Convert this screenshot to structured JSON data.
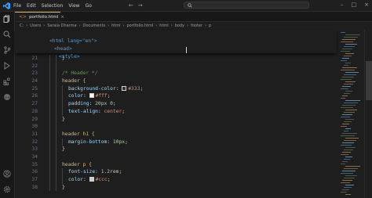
{
  "titlebar": {
    "menu": [
      "File",
      "Edit",
      "Selection",
      "View",
      "Go"
    ],
    "nav_back": "←",
    "nav_forward": "→"
  },
  "tab": {
    "filename": "portfolio.html",
    "close": "×"
  },
  "breadcrumb": [
    "C:",
    "Users",
    "Sarala Dharma",
    "Documents",
    "html",
    "portfolio.html",
    "html",
    "body",
    "footer",
    "p"
  ],
  "sticky_lines": [
    "<html lang=\"en\">",
    "<head>",
    "<style>"
  ],
  "lines": [
    {
      "n": "21",
      "text": "}"
    },
    {
      "n": "22",
      "text": ""
    },
    {
      "n": "23",
      "text": "/* Header */"
    },
    {
      "n": "24",
      "text": "header {"
    },
    {
      "n": "25",
      "text": "background-color: #333;"
    },
    {
      "n": "26",
      "text": "color: #fff;"
    },
    {
      "n": "27",
      "text": "padding: 20px 0;"
    },
    {
      "n": "28",
      "text": "text-align: center;"
    },
    {
      "n": "29",
      "text": "}"
    },
    {
      "n": "30",
      "text": ""
    },
    {
      "n": "31",
      "text": "header h1 {"
    },
    {
      "n": "32",
      "text": "margin-bottom: 10px;"
    },
    {
      "n": "33",
      "text": "}"
    },
    {
      "n": "34",
      "text": ""
    },
    {
      "n": "35",
      "text": "header p {"
    },
    {
      "n": "36",
      "text": "font-size: 1.2rem;"
    },
    {
      "n": "37",
      "text": "color: #ccc;"
    },
    {
      "n": "38",
      "text": "}"
    }
  ],
  "colors": {
    "editor_bg": "#1e1e1e",
    "selector": "#d7ba7d",
    "property": "#9cdcfe",
    "value": "#ce9178",
    "comment": "#6a9955",
    "number": "#b5cea8",
    "tag": "#569cd6"
  },
  "icons": {
    "activity": [
      "explorer-icon",
      "search-icon",
      "source-control-icon",
      "run-debug-icon",
      "extensions-icon",
      "remote-icon",
      "account-icon",
      "settings-icon"
    ]
  }
}
